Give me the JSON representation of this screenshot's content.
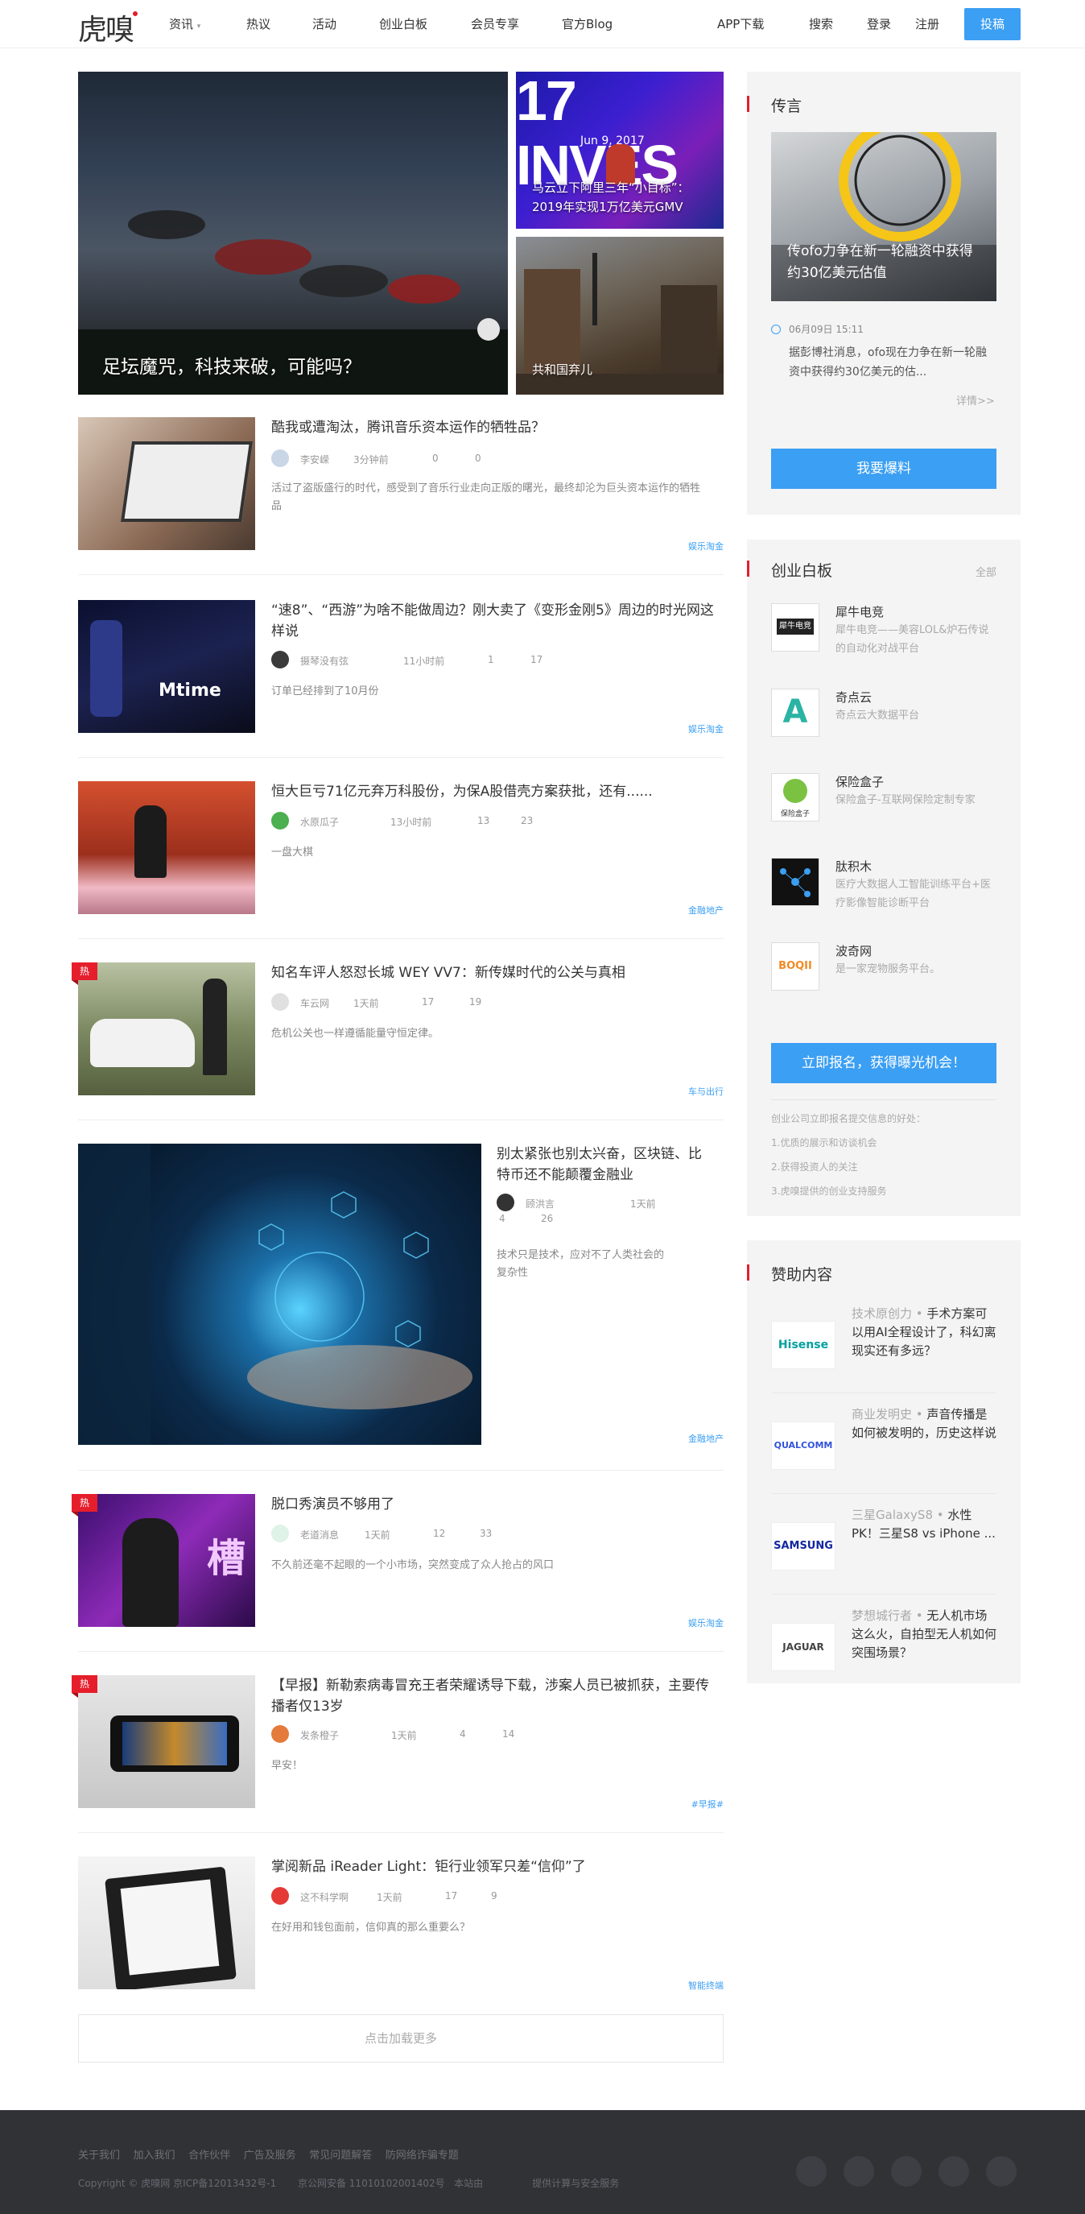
{
  "header": {
    "logo": "虎嗅",
    "nav": [
      "资讯",
      "热议",
      "活动",
      "创业白板",
      "会员专享",
      "官方Blog"
    ],
    "nav_dropdown_icon": "chevron-down-icon",
    "app_download": "APP下载",
    "search": "搜索",
    "login": "登录",
    "register": "注册",
    "post_button": "投稿"
  },
  "hero": {
    "main_title": "足坛魔咒，科技来破，可能吗？",
    "top_right_banner_text": "17 INVES",
    "top_right_date_text": "Jun 9, 2017",
    "top_right_title": "马云立下阿里三年“小目标”：2019年实现1万亿美元GMV",
    "bottom_right_title": "共和国弃儿"
  },
  "articles": [
    {
      "title": "酷我或遭淘汰，腾讯音乐资本运作的牺牲品？",
      "author": "李安嵘",
      "time": "3分钟前",
      "comments": "0",
      "likes": "0",
      "desc": "活过了盗版盛行的时代，感受到了音乐行业走向正版的曙光，最终却沦为巨头资本运作的牺牲品",
      "tag": "娱乐淘金",
      "hot": ""
    },
    {
      "title": "“速8”、“西游”为啥不能做周边？刚大卖了《变形金刚5》周边的时光网这样说",
      "author": "摄琴没有弦",
      "time": "11小时前",
      "comments": "1",
      "likes": "17",
      "desc": "订单已经排到了10月份",
      "tag": "娱乐淘金",
      "hot": ""
    },
    {
      "title": "恒大巨亏71亿元弃万科股份，为保A股借壳方案获批，还有......",
      "author": "水原瓜子",
      "time": "13小时前",
      "comments": "13",
      "likes": "23",
      "desc": "一盘大棋",
      "tag": "金融地产",
      "hot": ""
    },
    {
      "title": "知名车评人怒怼长城 WEY VV7：新传媒时代的公关与真相",
      "author": "车云网",
      "time": "1天前",
      "comments": "17",
      "likes": "19",
      "desc": "危机公关也一样遵循能量守恒定律。",
      "tag": "车与出行",
      "hot": "热"
    },
    {
      "title": "别太紧张也别太兴奋，区块链、比特币还不能颠覆金融业",
      "author": "顾洪言",
      "time": "1天前",
      "comments": "4",
      "likes": "26",
      "desc": "技术只是技术，应对不了人类社会的复杂性",
      "tag": "金融地产",
      "hot": ""
    },
    {
      "title": "脱口秀演员不够用了",
      "author": "老道消息",
      "time": "1天前",
      "comments": "12",
      "likes": "33",
      "desc": "不久前还毫不起眼的一个小市场，突然变成了众人抢占的风口",
      "tag": "娱乐淘金",
      "hot": "热"
    },
    {
      "title": "【早报】新勒索病毒冒充王者荣耀诱导下载，涉案人员已被抓获，主要传播者仅13岁",
      "author": "发条橙子",
      "time": "1天前",
      "comments": "4",
      "likes": "14",
      "desc": "早安！",
      "tag": "#早报#",
      "hot": "热"
    },
    {
      "title": "掌阅新品 iReader Light：钜行业领军只差“信仰”了",
      "author": "这不科学啊",
      "time": "1天前",
      "comments": "17",
      "likes": "9",
      "desc": "在好用和钱包面前，信仰真的那么重要么？",
      "tag": "智能终端",
      "hot": ""
    }
  ],
  "load_more": "点击加载更多",
  "sidebar": {
    "rumor": {
      "heading": "传言",
      "image_title": "传ofo力争在新一轮融资中获得约30亿美元估值",
      "date": "06月09日 15:11",
      "text": "据彭博社消息，ofo现在力争在新一轮融资中获得约30亿美元的估...",
      "detail_link": "详情>>",
      "button": "我要爆料",
      "clock_icon": "clock-icon"
    },
    "startup": {
      "heading": "创业白板",
      "all_link": "全部",
      "companies": [
        {
          "name": "犀牛电竞",
          "desc": "犀牛电竞——美容LOL&炉石传说的自动化对战平台",
          "logo_text": "犀牛电竞"
        },
        {
          "name": "奇点云",
          "desc": "奇点云大数据平台",
          "logo_text": "A"
        },
        {
          "name": "保险盒子",
          "desc": "保险盒子-互联网保险定制专家",
          "logo_text": "保险盒子"
        },
        {
          "name": "肽积木",
          "desc": "医疗大数据人工智能训练平台+医疗影像智能诊断平台",
          "logo_text": "肽积木"
        },
        {
          "name": "波奇网",
          "desc": "是一家宠物服务平台。",
          "logo_text": "BOQII"
        }
      ],
      "button": "立即报名，获得曝光机会！",
      "benefits_title": "创业公司立即报名提交信息的好处：",
      "benefits": [
        "1.优质的展示和访谈机会",
        "2.获得投资人的关注",
        "3.虎嗅提供的创业支持服务"
      ]
    },
    "sponsor": {
      "heading": "赞助内容",
      "items": [
        {
          "logo": "Hisense",
          "logo_color": "#00a0a0",
          "source": "技术原创力",
          "text": "手术方案可以用AI全程设计了，科幻离现实还有多远？"
        },
        {
          "logo": "QUALCOMM",
          "logo_color": "#3253dc",
          "source": "商业发明史",
          "text": "声音传播是如何被发明的，历史这样说"
        },
        {
          "logo": "SAMSUNG",
          "logo_color": "#1428a0",
          "source": "三星GalaxyS8",
          "text": "水性PK！三星S8 vs iPhone ..."
        },
        {
          "logo": "JAGUAR",
          "logo_color": "#444444",
          "source": "梦想城行者",
          "text": "无人机市场这么火，自拍型无人机如何突围场景？"
        }
      ]
    }
  },
  "footer": {
    "links": [
      "关于我们",
      "加入我们",
      "合作伙伴",
      "广告及服务",
      "常见问题解答",
      "防网络诈骗专题"
    ],
    "copyright": "Copyright © 虎嗅网 京ICP备12013432号-1",
    "police": "京公网安备 11010102001402号",
    "site_map": "本站由",
    "provider": "提供计算与安全服务"
  },
  "colors": {
    "accent_blue": "#3b9ff3",
    "hot_red": "#e61e2b",
    "footer_bg": "#303236"
  }
}
